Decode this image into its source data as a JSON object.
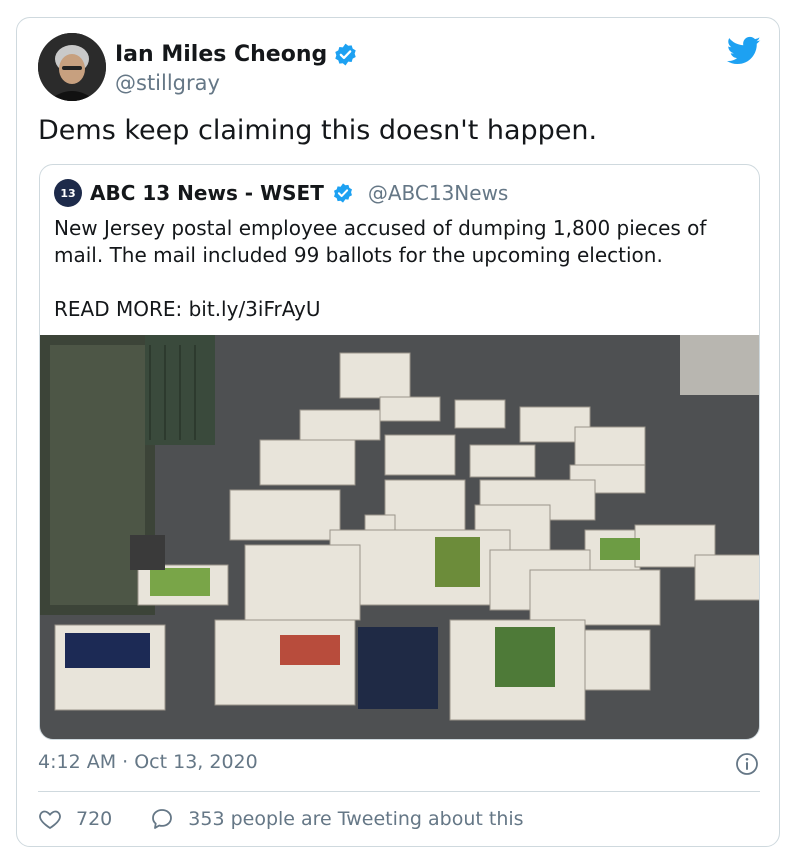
{
  "tweet": {
    "author": {
      "name": "Ian Miles Cheong",
      "handle": "@stillgray",
      "verified": true,
      "avatar_icon": "avatar-portrait"
    },
    "text": "Dems keep claiming this doesn't happen.",
    "timestamp": "4:12 AM · Oct 13, 2020",
    "likes": "720",
    "retweet_text": "353 people are Tweeting about this",
    "brand_icon": "twitter-bird-icon",
    "colors": {
      "accent": "#1DA1F2",
      "muted": "#657786",
      "border": "#cfd9de"
    }
  },
  "quoted": {
    "logo_text": "13",
    "name": "ABC 13 News - WSET",
    "handle": "@ABC13News",
    "verified": true,
    "text": "New Jersey postal employee accused of dumping 1,800 pieces of mail. The mail included 99 ballots for the upcoming election.",
    "read_more": "READ MORE: bit.ly/3iFrAyU"
  }
}
